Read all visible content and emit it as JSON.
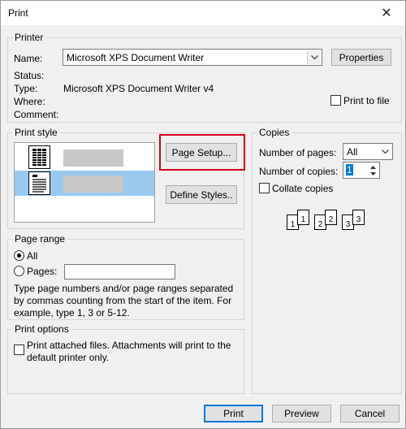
{
  "window": {
    "title": "Print",
    "close_glyph": "✕"
  },
  "printer": {
    "group_label": "Printer",
    "name_label": "Name:",
    "name_value": "Microsoft XPS Document Writer",
    "properties_button": "Properties",
    "status_label": "Status:",
    "status_value": "",
    "type_label": "Type:",
    "type_value": "Microsoft XPS Document Writer v4",
    "where_label": "Where:",
    "where_value": "",
    "comment_label": "Comment:",
    "comment_value": "",
    "print_to_file_label": "Print to file",
    "print_to_file_checked": false
  },
  "print_style": {
    "group_label": "Print style",
    "page_setup_button": "Page Setup...",
    "define_styles_button": "Define Styles..",
    "selected_index": 1
  },
  "copies": {
    "group_label": "Copies",
    "number_of_pages_label": "Number of pages:",
    "number_of_pages_value": "All",
    "number_of_copies_label": "Number of copies:",
    "number_of_copies_value": "1",
    "collate_label": "Collate copies",
    "collate_checked": false,
    "collate_sheets": [
      "1",
      "1",
      "2",
      "2",
      "3",
      "3"
    ]
  },
  "page_range": {
    "group_label": "Page range",
    "all_label": "All",
    "pages_label": "Pages:",
    "pages_value": "",
    "selected": "all",
    "help_text": "Type page numbers and/or page ranges separated by commas counting from the start of the item.  For example, type 1, 3 or 5-12."
  },
  "print_options": {
    "group_label": "Print options",
    "attached_files_label": "Print attached files.  Attachments will print to the default printer only.",
    "attached_files_checked": false
  },
  "footer": {
    "print_button": "Print",
    "preview_button": "Preview",
    "cancel_button": "Cancel"
  },
  "colors": {
    "highlight_frame": "#d9001b",
    "selected_row": "#99c9ef",
    "default_button_border": "#0078d7"
  }
}
